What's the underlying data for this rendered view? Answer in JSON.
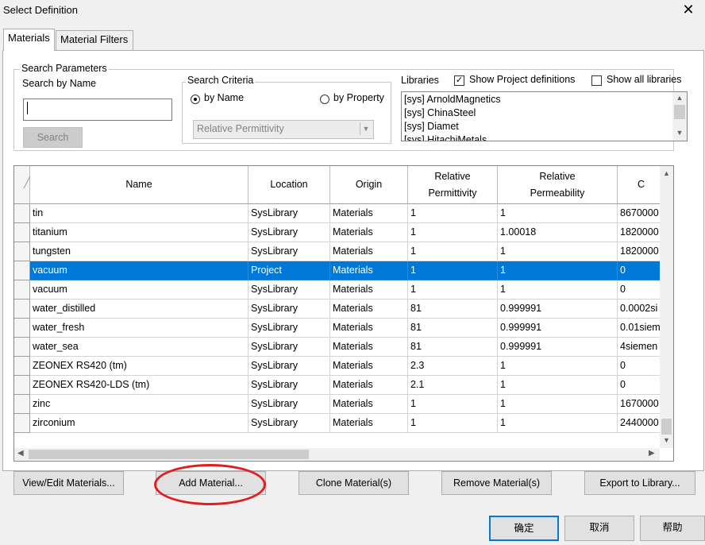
{
  "window": {
    "title": "Select Definition",
    "close_glyph": "✕"
  },
  "tabs": [
    {
      "label": "Materials"
    },
    {
      "label": "Material Filters"
    }
  ],
  "search": {
    "group_label": "Search Parameters",
    "by_name_label": "Search by Name",
    "name_value": "",
    "button_label": "Search",
    "criteria": {
      "group_label": "Search Criteria",
      "by_name_label": "by Name",
      "by_property_label": "by Property",
      "selected": "by Name",
      "property_select_value": "Relative Permittivity"
    }
  },
  "libraries": {
    "label": "Libraries",
    "show_project_label": "Show Project definitions",
    "show_project_checked": true,
    "show_all_label": "Show all libraries",
    "show_all_checked": false,
    "items": [
      "[sys] ArnoldMagnetics",
      "[sys] ChinaSteel",
      "[sys] Diamet",
      "[sys] HitachiMetals"
    ]
  },
  "table": {
    "sort_glyph": "╱",
    "columns": [
      {
        "label": "Name"
      },
      {
        "label": "Location"
      },
      {
        "label": "Origin"
      },
      {
        "label": "Relative\nPermittivity"
      },
      {
        "label": "Relative\nPermeability"
      },
      {
        "label": "C"
      }
    ],
    "rows": [
      {
        "name": "tin",
        "location": "SysLibrary",
        "origin": "Materials",
        "permittivity": "1",
        "permeability": "1",
        "extra": "8670000",
        "selected": false
      },
      {
        "name": "titanium",
        "location": "SysLibrary",
        "origin": "Materials",
        "permittivity": "1",
        "permeability": "1.00018",
        "extra": "1820000",
        "selected": false
      },
      {
        "name": "tungsten",
        "location": "SysLibrary",
        "origin": "Materials",
        "permittivity": "1",
        "permeability": "1",
        "extra": "1820000",
        "selected": false
      },
      {
        "name": "vacuum",
        "location": "Project",
        "origin": "Materials",
        "permittivity": "1",
        "permeability": "1",
        "extra": "0",
        "selected": true
      },
      {
        "name": "vacuum",
        "location": "SysLibrary",
        "origin": "Materials",
        "permittivity": "1",
        "permeability": "1",
        "extra": "0",
        "selected": false
      },
      {
        "name": "water_distilled",
        "location": "SysLibrary",
        "origin": "Materials",
        "permittivity": "81",
        "permeability": "0.999991",
        "extra": "0.0002si",
        "selected": false
      },
      {
        "name": "water_fresh",
        "location": "SysLibrary",
        "origin": "Materials",
        "permittivity": "81",
        "permeability": "0.999991",
        "extra": "0.01siem",
        "selected": false
      },
      {
        "name": "water_sea",
        "location": "SysLibrary",
        "origin": "Materials",
        "permittivity": "81",
        "permeability": "0.999991",
        "extra": "4siemen",
        "selected": false
      },
      {
        "name": "ZEONEX RS420 (tm)",
        "location": "SysLibrary",
        "origin": "Materials",
        "permittivity": "2.3",
        "permeability": "1",
        "extra": "0",
        "selected": false
      },
      {
        "name": "ZEONEX RS420-LDS (tm)",
        "location": "SysLibrary",
        "origin": "Materials",
        "permittivity": "2.1",
        "permeability": "1",
        "extra": "0",
        "selected": false
      },
      {
        "name": "zinc",
        "location": "SysLibrary",
        "origin": "Materials",
        "permittivity": "1",
        "permeability": "1",
        "extra": "1670000",
        "selected": false
      },
      {
        "name": "zirconium",
        "location": "SysLibrary",
        "origin": "Materials",
        "permittivity": "1",
        "permeability": "1",
        "extra": "2440000",
        "selected": false
      }
    ]
  },
  "actions": {
    "view_edit": "View/Edit Materials...",
    "add": "Add Material...",
    "clone": "Clone Material(s)",
    "remove": "Remove Material(s)",
    "export": "Export to Library..."
  },
  "footer": {
    "ok": "确定",
    "cancel": "取消",
    "help": "帮助"
  },
  "colors": {
    "selection": "#0078d7",
    "annotation_circle": "#e02020"
  }
}
